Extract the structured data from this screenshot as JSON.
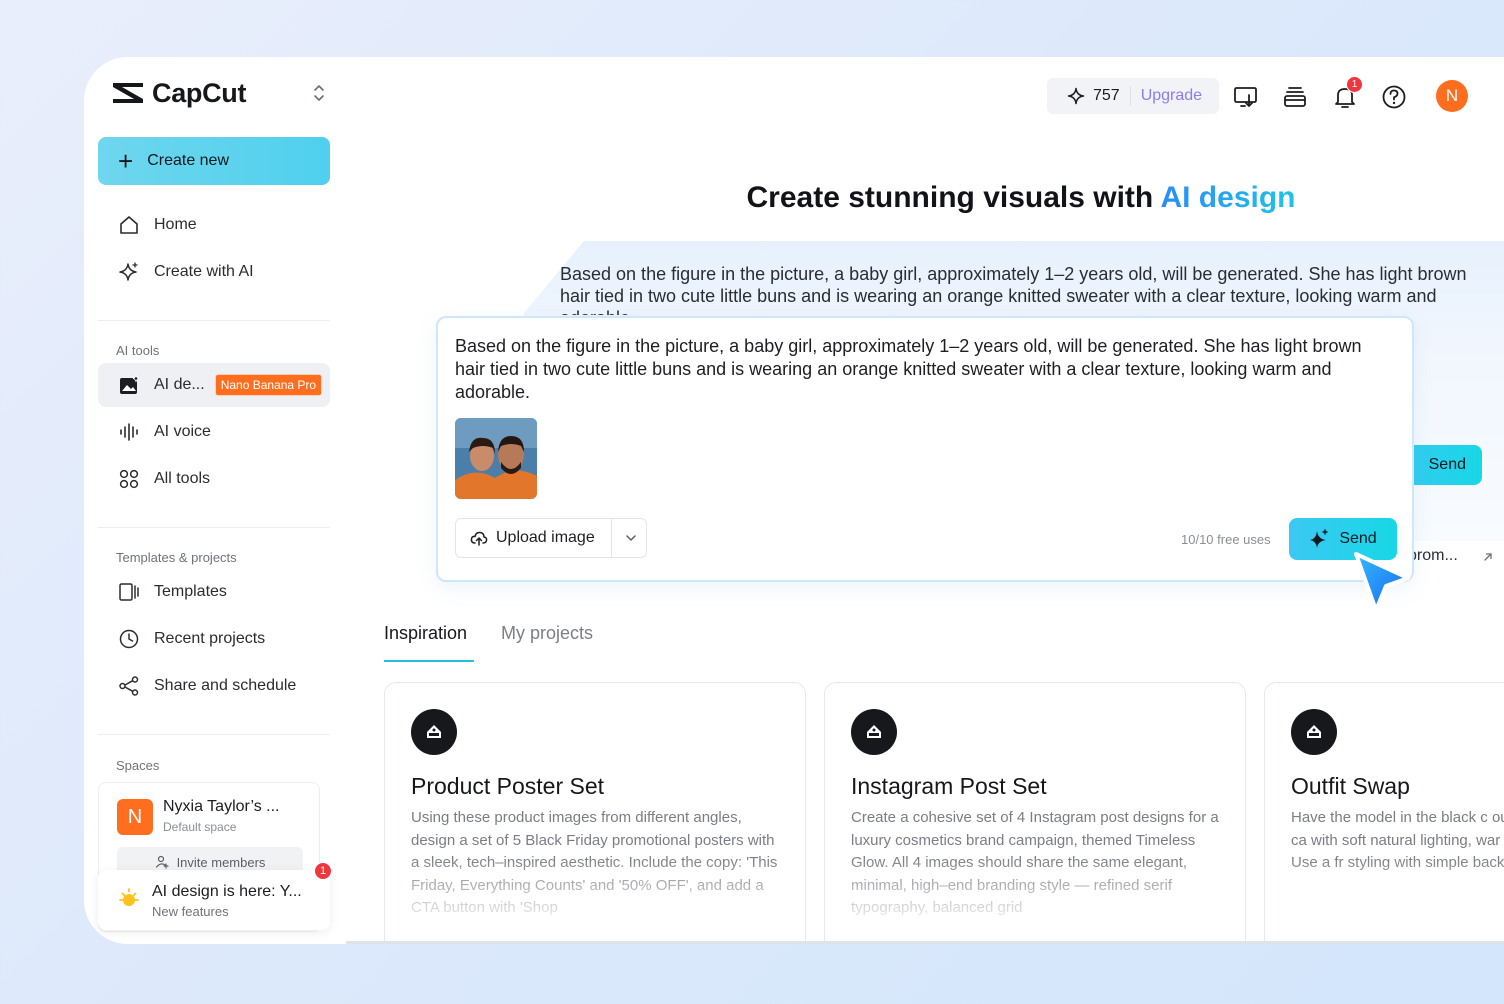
{
  "app": {
    "name": "CapCut"
  },
  "sidebar": {
    "create_new": "Create new",
    "nav_main": [
      {
        "label": "Home",
        "icon": "home-icon"
      },
      {
        "label": "Create with AI",
        "icon": "sparkle-icon"
      }
    ],
    "ai_tools_label": "AI tools",
    "ai_tools": [
      {
        "label": "AI de...",
        "badge": "Nano Banana Pro",
        "icon": "image-sparkle-icon",
        "active": true
      },
      {
        "label": "AI voice",
        "icon": "waveform-icon"
      },
      {
        "label": "All tools",
        "icon": "grid-icon"
      }
    ],
    "templates_label": "Templates & projects",
    "templates": [
      {
        "label": "Templates",
        "icon": "template-icon"
      },
      {
        "label": "Recent projects",
        "icon": "clock-icon"
      },
      {
        "label": "Share and schedule",
        "icon": "share-icon"
      }
    ],
    "spaces_label": "Spaces",
    "space": {
      "avatar": "N",
      "name": "Nyxia Taylor’s ...",
      "sub": "Default space",
      "invite": "Invite members"
    },
    "notice": {
      "title": "AI design is here: Y...",
      "sub": "New features",
      "badge": "1"
    }
  },
  "topbar": {
    "credits": "757",
    "upgrade": "Upgrade",
    "bell_badge": "1",
    "avatar": "N",
    "icons": [
      "monitor-download-icon",
      "stack-icon",
      "bell-icon",
      "help-icon"
    ]
  },
  "hero": {
    "title_prefix": "Create stunning visuals with ",
    "title_accent": "AI design"
  },
  "back_card": {
    "text": "Based on the figure in the picture, a baby girl, approximately 1–2 years old, will be generated. She has light brown hair tied in two cute little buns and is wearing an orange knitted sweater with a clear texture, looking warm and adorable.",
    "send": "Send",
    "link": "prom..."
  },
  "prompt": {
    "text": "Based on the figure in the picture, a baby girl, approximately 1–2 years old, will be generated. She has light brown hair tied in two cute little buns and is wearing an orange knitted sweater with a clear texture, looking warm and adorable.",
    "upload": "Upload image",
    "free_uses": "10/10 free uses",
    "send": "Send"
  },
  "tabs": [
    {
      "label": "Inspiration",
      "active": true
    },
    {
      "label": "My projects",
      "active": false
    }
  ],
  "cards": [
    {
      "title": "Product Poster Set",
      "desc": "Using these product images from different angles, design a set of 5 Black Friday promotional posters with a sleek, tech–inspired aesthetic. Include the copy: 'This Friday, Everything Counts' and '50% OFF', and add a CTA button with 'Shop"
    },
    {
      "title": "Instagram Post Set",
      "desc": "Create a cohesive set of 4 Instagram post designs for a luxury cosmetics brand campaign, themed Timeless Glow. All 4 images should share the same elegant, minimal, high–end branding style — refined serif typography, balanced grid"
    },
    {
      "title": "Outfit Swap",
      "desc": "Have the model in the black c outfit. Place her in a cozy, ca with soft natural lighting, war relaxed atmosphere. Use a fr styling with simple backgrour"
    }
  ],
  "colors": {
    "accent": "#21c0e0",
    "orange": "#ff6e1f",
    "badge_red": "#f0363c",
    "upgrade": "#8e7bf4"
  }
}
